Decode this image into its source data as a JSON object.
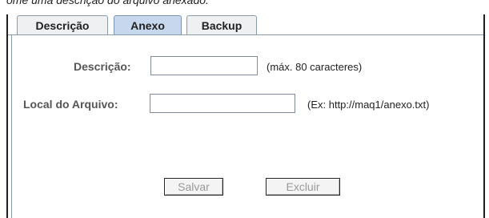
{
  "caption": "ome uma descrição do arquivo anexado.",
  "tabs": [
    {
      "label": "Descrição",
      "active": false
    },
    {
      "label": "Anexo",
      "active": true
    },
    {
      "label": "Backup",
      "active": false
    }
  ],
  "form": {
    "descricao": {
      "label": "Descrição:",
      "value": "",
      "hint": "(máx. 80 caracteres)"
    },
    "local": {
      "label": "Local do Arquivo:",
      "value": "",
      "hint": "(Ex: http://maq1/anexo.txt)"
    }
  },
  "buttons": {
    "salvar": "Salvar",
    "excluir": "Excluir"
  },
  "colors": {
    "active_tab": "#c7d8ee",
    "disabled_text": "#9a9a9a"
  }
}
